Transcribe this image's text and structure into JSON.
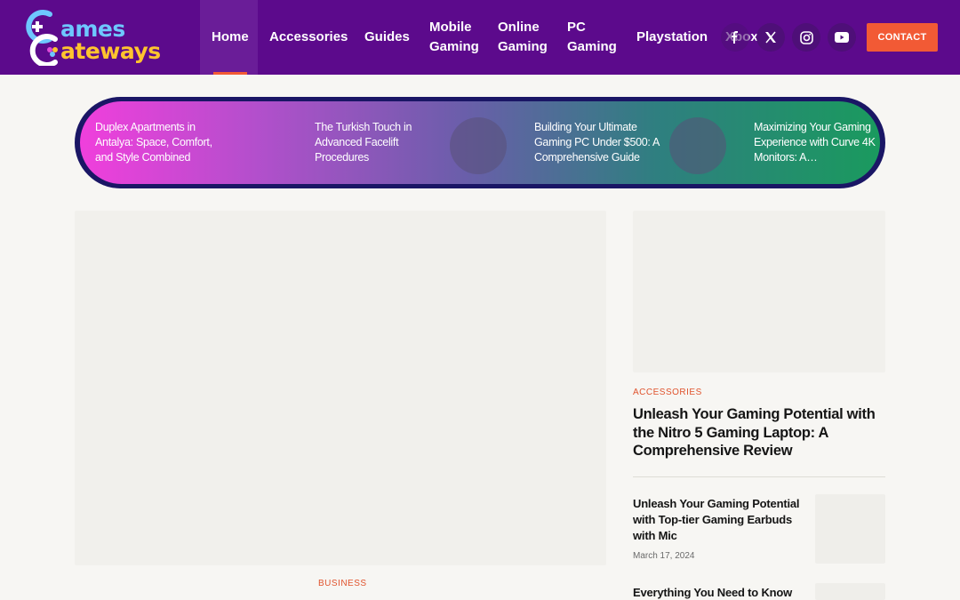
{
  "brand": {
    "line1": "ames",
    "line2": "ateways",
    "colors": {
      "blue": "#6ec7ff",
      "yellow": "#ffc42e",
      "header": "#5c0a8c",
      "accent": "#f25a35"
    }
  },
  "nav": {
    "home": "Home",
    "accessories": "Accessories",
    "guides": "Guides",
    "mobile_1": "Mobile",
    "mobile_2": "Gaming",
    "online_1": "Online",
    "online_2": "Gaming",
    "pc_1": "PC",
    "pc_2": "Gaming",
    "playstation": "Playstation",
    "xbox": "Xbox"
  },
  "social": [
    "facebook-icon",
    "x-icon",
    "instagram-icon",
    "youtube-icon"
  ],
  "contact_label": "CONTACT",
  "ticker": [
    "Duplex Apartments in Antalya: Space, Comfort, and Style Combined",
    "The Turkish Touch in Advanced Facelift Procedures",
    "Building Your Ultimate Gaming PC Under $500: A Comprehensive Guide",
    "Maximizing Your Gaming Experience with Curve 4K Monitors: A…"
  ],
  "feature": {
    "category": "BUSINESS"
  },
  "sidebar": {
    "main": {
      "category": "ACCESSORIES",
      "title": "Unleash Your Gaming Potential with the Nitro 5 Gaming Laptop: A Comprehensive Review"
    },
    "list": [
      {
        "title": "Unleash Your Gaming Potential with Top-tier Gaming Earbuds with Mic",
        "date": "March 17, 2024"
      },
      {
        "title": "Everything You Need to Know"
      }
    ]
  }
}
